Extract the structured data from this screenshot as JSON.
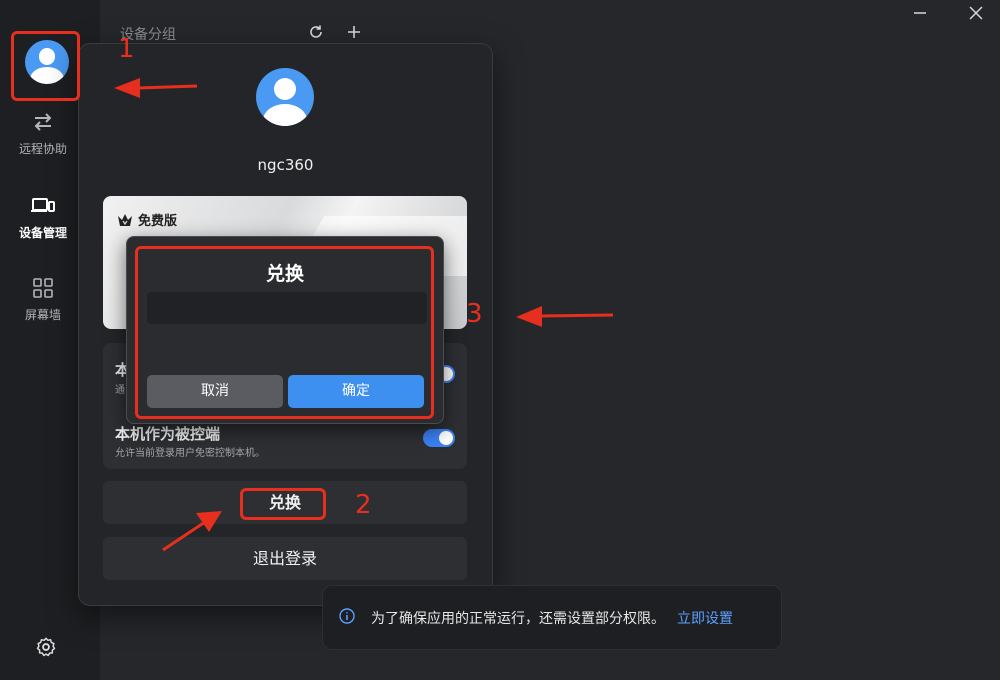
{
  "sidebar": {
    "items": [
      {
        "label": "远程协助",
        "icon": "swap-arrows-icon"
      },
      {
        "label": "设备管理",
        "icon": "devices-icon",
        "active": true
      },
      {
        "label": "屏幕墙",
        "icon": "grid-icon"
      }
    ],
    "settings_icon": "gear-icon"
  },
  "topbar": {
    "title": "设备分组"
  },
  "profile": {
    "username": "ngc360",
    "plan": "免费版",
    "settings": [
      {
        "title": "本",
        "subtitle": "通",
        "enabled": true
      },
      {
        "title": "本机作为被控端",
        "subtitle": "允许当前登录用户免密控制本机。",
        "enabled": true
      }
    ],
    "exchange_label": "兑换",
    "logout_label": "退出登录"
  },
  "dialog": {
    "title": "兑换",
    "input_value": "",
    "cancel_label": "取消",
    "ok_label": "确定"
  },
  "annotations": [
    "1",
    "2",
    "3"
  ],
  "notice": {
    "text": "为了确保应用的正常运行，还需设置部分权限。",
    "link": "立即设置"
  },
  "colors": {
    "accent": "#3d8ff0",
    "annotation": "#e62f1e",
    "avatar": "#4a9af3"
  }
}
